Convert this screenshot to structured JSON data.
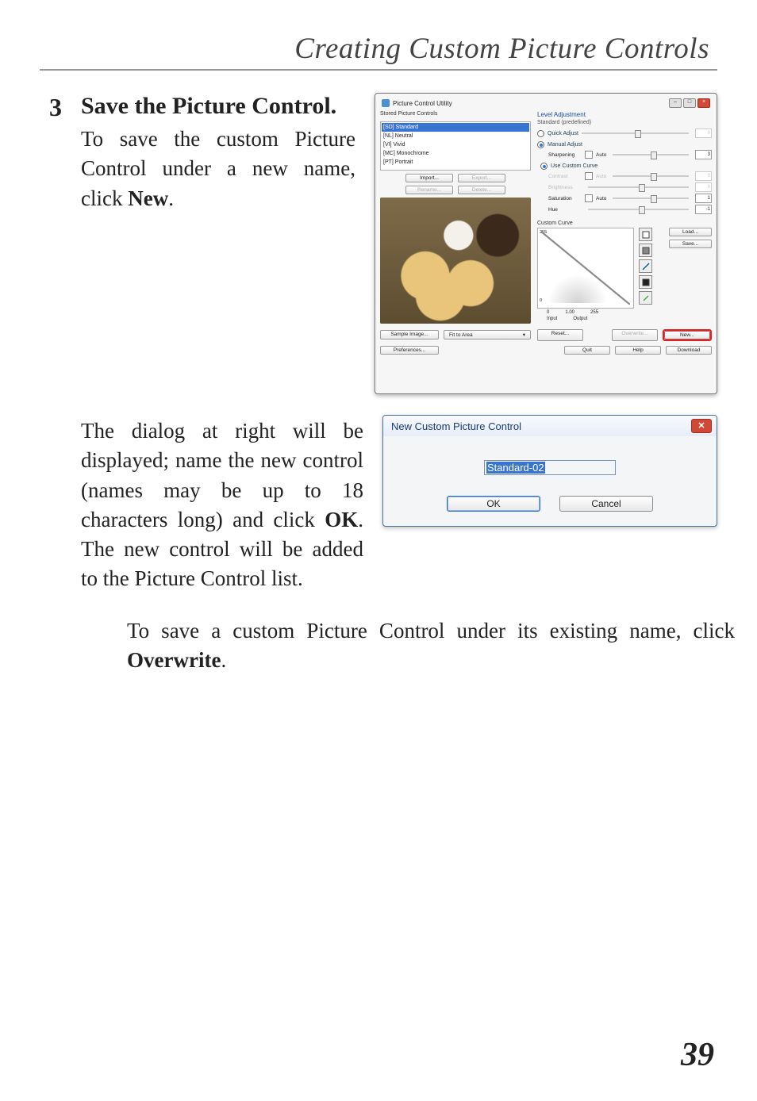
{
  "chapter_title": "Creating Custom Picture Controls",
  "step_number": "3",
  "step_heading": "Save the Picture Control.",
  "step_body_pre": "To save the custom Picture Control under a new name, click ",
  "step_body_key": "New",
  "step_body_post": ".",
  "pcu": {
    "window_title": "Picture Control Utility",
    "left_panel_label": "Stored Picture Controls",
    "list": {
      "selected": "[SD] Standard",
      "items": [
        "[NL] Neutral",
        "[VI] Vivid",
        "[MC] Monochrome",
        "[PT] Portrait"
      ]
    },
    "import_btn": "Import...",
    "export_btn": "Export...",
    "rename_btn": "Rename...",
    "delete_btn": "Delete...",
    "sample_btn": "Sample Image...",
    "fit_label": "Fit to Area",
    "prefs_btn": "Preferences...",
    "right_title": "Level Adjustment",
    "right_sub": "Standard (predefined)",
    "quick_label": "Quick Adjust",
    "manual_label": "Manual Adjust",
    "sharpening": "Sharpening",
    "auto": "Auto",
    "usecurve": "Use Custom Curve",
    "contrast": "Contrast",
    "brightness": "Brightness",
    "saturation": "Saturation",
    "hue": "Hue",
    "val0": "0",
    "val3": "3",
    "val1": "1",
    "valm1": "-1",
    "curve_label": "Custom Curve",
    "y255": "255",
    "y0": "0",
    "x0": "0",
    "xmid": "1.00",
    "x255": "255",
    "input_lbl": "Input",
    "output_lbl": "Output",
    "load_btn": "Load...",
    "save_btn": "Save...",
    "reset_btn": "Reset...",
    "overwrite_btn": "Overwrite...",
    "new_btn": "New...",
    "quit_btn": "Quit",
    "help_btn": "Help",
    "download_btn": "Download"
  },
  "row2_text_parts": [
    "The dialog at right will be displayed; name the new control (names may be up to 18 characters long) and click ",
    "OK",
    ". The new control will be added to the Picture Control list."
  ],
  "dlg": {
    "title": "New Custom Picture Control",
    "value": "Standard-02",
    "ok": "OK",
    "cancel": "Cancel"
  },
  "after_para": [
    "To save a custom Picture Control under its existing name, click ",
    "Overwrite",
    "."
  ],
  "page_number": "39"
}
